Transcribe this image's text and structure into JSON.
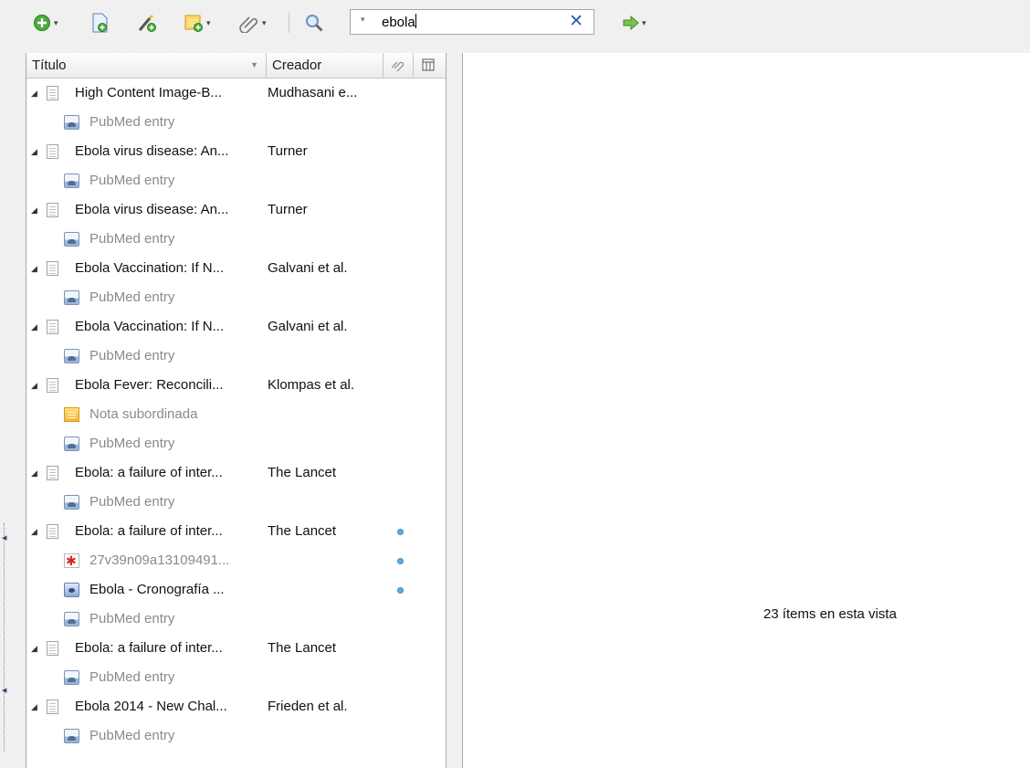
{
  "toolbar": {
    "buttons": [
      {
        "name": "new-item-button",
        "icon": "plus-circle-icon",
        "has_menu": true
      },
      {
        "name": "new-item-from-doc-button",
        "icon": "document-add-icon",
        "has_menu": false
      },
      {
        "name": "add-by-identifier-button",
        "icon": "magic-wand-icon",
        "has_menu": false
      },
      {
        "name": "new-note-button",
        "icon": "note-add-icon",
        "has_menu": true
      },
      {
        "name": "add-attachment-button",
        "icon": "paperclip-icon",
        "has_menu": true
      },
      {
        "name": "advanced-search-button",
        "icon": "magnifier-icon",
        "has_menu": false
      },
      {
        "name": "locate-button",
        "icon": "green-arrow-icon",
        "has_menu": true
      }
    ],
    "search": {
      "value": "ebola",
      "clear_glyph": "✕"
    }
  },
  "columns": {
    "title": "Título",
    "creator": "Creador"
  },
  "rows": [
    {
      "kind": "parent",
      "title": "High Content Image-B...",
      "creator": "Mudhasani e..."
    },
    {
      "kind": "child",
      "icon": "web",
      "text": "PubMed entry"
    },
    {
      "kind": "parent",
      "title": "Ebola virus disease: An...",
      "creator": "Turner"
    },
    {
      "kind": "child",
      "icon": "web",
      "text": "PubMed entry"
    },
    {
      "kind": "parent",
      "title": "Ebola virus disease: An...",
      "creator": "Turner"
    },
    {
      "kind": "child",
      "icon": "web",
      "text": "PubMed entry"
    },
    {
      "kind": "parent",
      "title": "Ebola Vaccination: If N...",
      "creator": "Galvani et al."
    },
    {
      "kind": "child",
      "icon": "web",
      "text": "PubMed entry"
    },
    {
      "kind": "parent",
      "title": "Ebola Vaccination: If N...",
      "creator": "Galvani et al."
    },
    {
      "kind": "child",
      "icon": "web",
      "text": "PubMed entry"
    },
    {
      "kind": "parent",
      "title": "Ebola Fever: Reconcili...",
      "creator": "Klompas et al."
    },
    {
      "kind": "child",
      "icon": "note",
      "text": "Nota subordinada"
    },
    {
      "kind": "child",
      "icon": "web",
      "text": "PubMed entry"
    },
    {
      "kind": "parent",
      "title": "Ebola: a failure of inter...",
      "creator": "The Lancet"
    },
    {
      "kind": "child",
      "icon": "web",
      "text": "PubMed entry"
    },
    {
      "kind": "parent",
      "title": "Ebola: a failure of inter...",
      "creator": "The Lancet",
      "attachment_dot": true
    },
    {
      "kind": "child",
      "icon": "pdf",
      "text": "27v39n09a13109491...",
      "attachment_dot": true
    },
    {
      "kind": "child",
      "icon": "snapshot",
      "text": "Ebola - Cronografía ...",
      "attachment_dot": true,
      "dark": true
    },
    {
      "kind": "child",
      "icon": "web",
      "text": "PubMed entry"
    },
    {
      "kind": "parent",
      "title": "Ebola: a failure of inter...",
      "creator": "The Lancet"
    },
    {
      "kind": "child",
      "icon": "web",
      "text": "PubMed entry"
    },
    {
      "kind": "parent",
      "title": "Ebola 2014 - New Chal...",
      "creator": "Frieden et al."
    },
    {
      "kind": "child",
      "icon": "web",
      "text": "PubMed entry"
    }
  ],
  "item_pane": {
    "count_text": "23 ítems en esta vista"
  },
  "colors": {
    "accent": "#2a5db0",
    "dot": "#5aaee0",
    "pdf": "#d6281f"
  }
}
